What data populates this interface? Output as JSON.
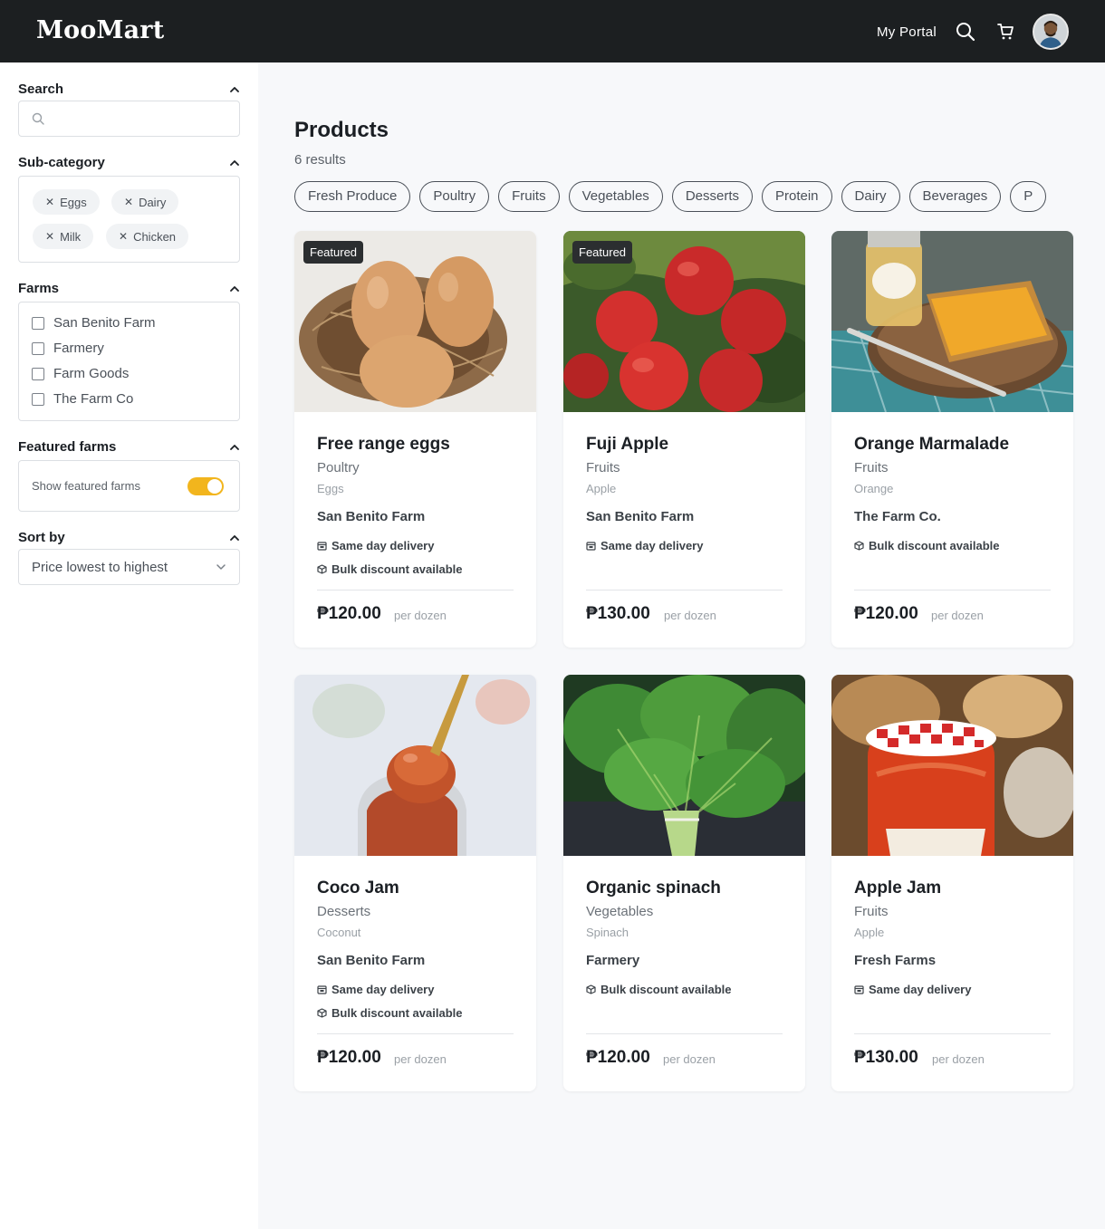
{
  "header": {
    "logo": "MooMart",
    "portal_link": "My Portal",
    "icons": [
      "search-icon",
      "cart-icon"
    ]
  },
  "sidebar": {
    "search": {
      "title": "Search",
      "placeholder": ""
    },
    "subcategory": {
      "title": "Sub-category",
      "chips": [
        "Eggs",
        "Dairy",
        "Milk",
        "Chicken"
      ]
    },
    "farms": {
      "title": "Farms",
      "options": [
        "San Benito Farm",
        "Farmery",
        "Farm Goods",
        "The Farm Co"
      ]
    },
    "featured_farms": {
      "title": "Featured farms",
      "toggle_label": "Show featured farms",
      "enabled": true
    },
    "sort": {
      "title": "Sort by",
      "selected": "Price lowest to highest"
    }
  },
  "main": {
    "title": "Products",
    "result_count": "6 results",
    "category_pills": [
      "Fresh Produce",
      "Poultry",
      "Fruits",
      "Vegetables",
      "Desserts",
      "Protein",
      "Dairy",
      "Beverages",
      "P"
    ],
    "badge_label": "Featured",
    "products": [
      {
        "name": "Free range eggs",
        "category": "Poultry",
        "subcategory": "Eggs",
        "farm": "San Benito Farm",
        "featured": true,
        "features": [
          "Same day delivery",
          "Bulk discount available"
        ],
        "price": "₱120.00",
        "unit": "per dozen"
      },
      {
        "name": "Fuji Apple",
        "category": "Fruits",
        "subcategory": "Apple",
        "farm": "San Benito Farm",
        "featured": true,
        "features": [
          "Same day delivery"
        ],
        "price": "₱130.00",
        "unit": "per dozen"
      },
      {
        "name": "Orange Marmalade",
        "category": "Fruits",
        "subcategory": "Orange",
        "farm": "The Farm Co.",
        "featured": false,
        "features": [
          "Bulk discount available"
        ],
        "price": "₱120.00",
        "unit": "per dozen"
      },
      {
        "name": "Coco Jam",
        "category": "Desserts",
        "subcategory": "Coconut",
        "farm": "San Benito Farm",
        "featured": false,
        "features": [
          "Same day delivery",
          "Bulk discount available"
        ],
        "price": "₱120.00",
        "unit": "per dozen"
      },
      {
        "name": "Organic spinach",
        "category": "Vegetables",
        "subcategory": "Spinach",
        "farm": "Farmery",
        "featured": false,
        "features": [
          "Bulk discount available"
        ],
        "price": "₱120.00",
        "unit": "per dozen"
      },
      {
        "name": "Apple Jam",
        "category": "Fruits",
        "subcategory": "Apple",
        "farm": "Fresh Farms",
        "featured": false,
        "features": [
          "Same day delivery"
        ],
        "price": "₱130.00",
        "unit": "per dozen"
      }
    ]
  },
  "colors": {
    "header_bg": "#1c1f21",
    "toggle_on": "#f2b51d",
    "page_bg": "#f7f8fa"
  }
}
